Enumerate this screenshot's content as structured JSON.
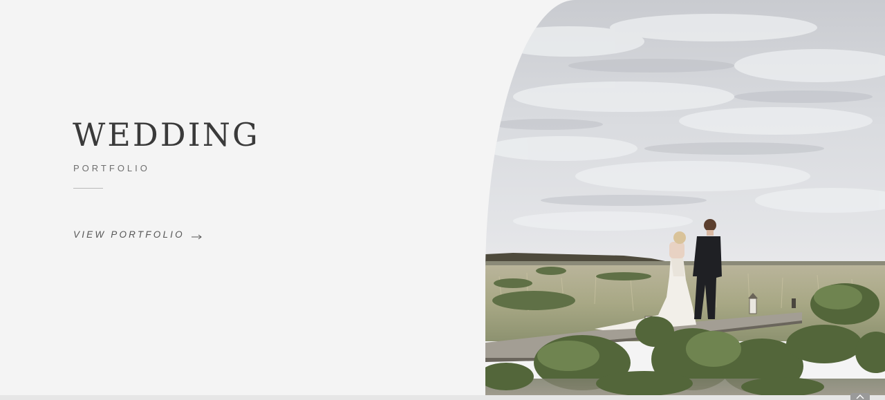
{
  "hero": {
    "title": "WEDDING",
    "subtitle": "PORTFOLIO",
    "cta_label": "VIEW PORTFOLIO",
    "cta_icon": "arrow-right-icon"
  },
  "photo": {
    "subject": "bride-and-groom-walking-boardwalk-image"
  },
  "controls": {
    "scroll_top_icon": "chevron-up-icon"
  },
  "colors": {
    "background": "#f4f4f4",
    "text_dark": "#3a3a3a",
    "text_muted": "#6e6e6e"
  }
}
